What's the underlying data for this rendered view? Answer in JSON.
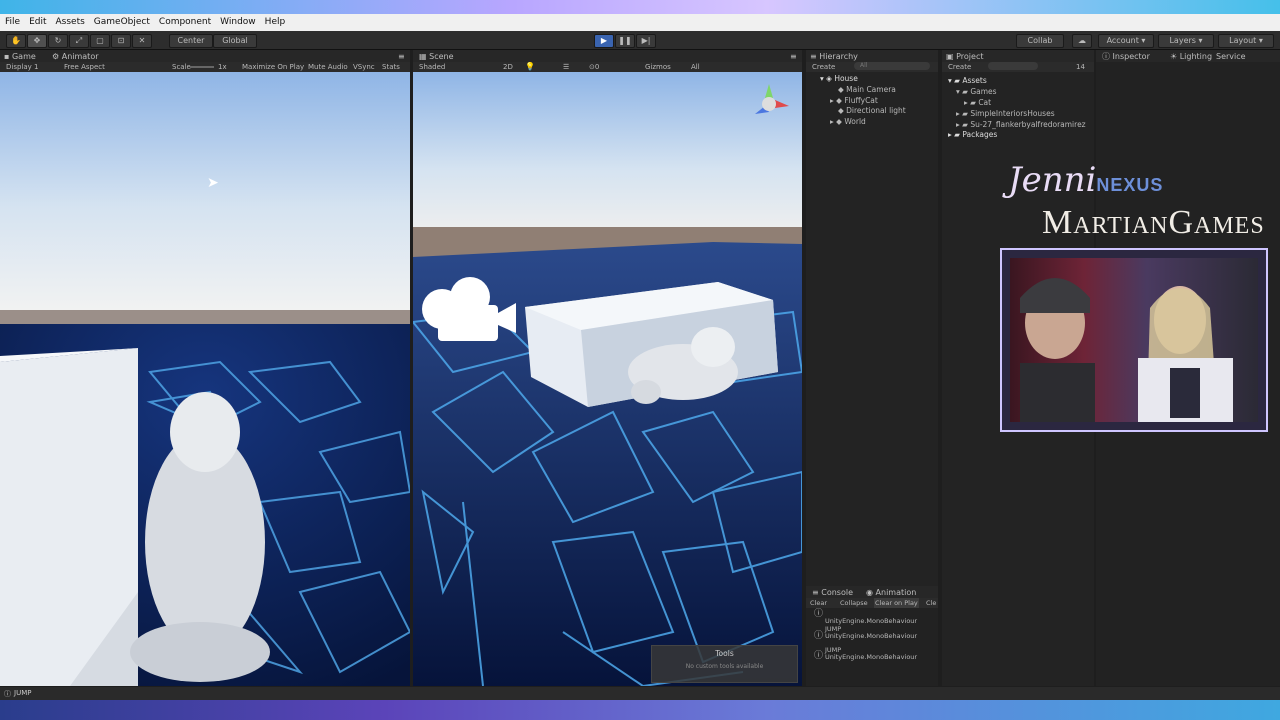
{
  "menu": [
    "File",
    "Edit",
    "Assets",
    "GameObject",
    "Component",
    "Window",
    "Help"
  ],
  "toolbar": {
    "pivot": "Center",
    "space": "Global",
    "collab": "Collab",
    "account": "Account",
    "layers": "Layers",
    "layout": "Layout"
  },
  "game_panel": {
    "tabs": [
      "Game",
      "Animator"
    ],
    "display": "Display 1",
    "aspect": "Free Aspect",
    "scale_label": "Scale",
    "scale_value": "1x",
    "maximize": "Maximize On Play",
    "mute": "Mute Audio",
    "vsync": "VSync",
    "stats": "Stats"
  },
  "scene_panel": {
    "tab": "Scene",
    "shading": "Shaded",
    "mode_2d": "2D",
    "gizmos": "Gizmos",
    "search": "All",
    "tools_title": "Tools",
    "tools_sub": "No custom tools available"
  },
  "hierarchy": {
    "tab": "Hierarchy",
    "create": "Create",
    "search": "All",
    "scene": "House",
    "items": [
      "Main Camera",
      "FluffyCat",
      "Directional light",
      "World"
    ]
  },
  "project": {
    "tab": "Project",
    "create": "Create",
    "items": [
      "Assets",
      "Games",
      "Cat",
      "SimpleInteriorsHouses",
      "Su-27_flankerbyalfredoramirez",
      "Packages"
    ],
    "count": "14"
  },
  "inspector": {
    "tabs": [
      "Inspector",
      "Lighting",
      "Service"
    ]
  },
  "console": {
    "tabs": [
      "Console",
      "Animation"
    ],
    "buttons": [
      "Clear",
      "Collapse",
      "Clear on Play",
      "Cle"
    ],
    "logs": [
      {
        "line1": "",
        "line2": "UnityEngine.MonoBehaviour"
      },
      {
        "line1": "JUMP",
        "line2": "UnityEngine.MonoBehaviour"
      },
      {
        "line1": "JUMP",
        "line2": "UnityEngine.MonoBehaviour"
      },
      {
        "line1": "JUMP",
        "line2": "UnityEngine.MonoBehaviour"
      }
    ]
  },
  "status": "JUMP",
  "overlay": {
    "name1": "Jenni",
    "name2": "NEXUS",
    "brand": "MartianGames"
  }
}
